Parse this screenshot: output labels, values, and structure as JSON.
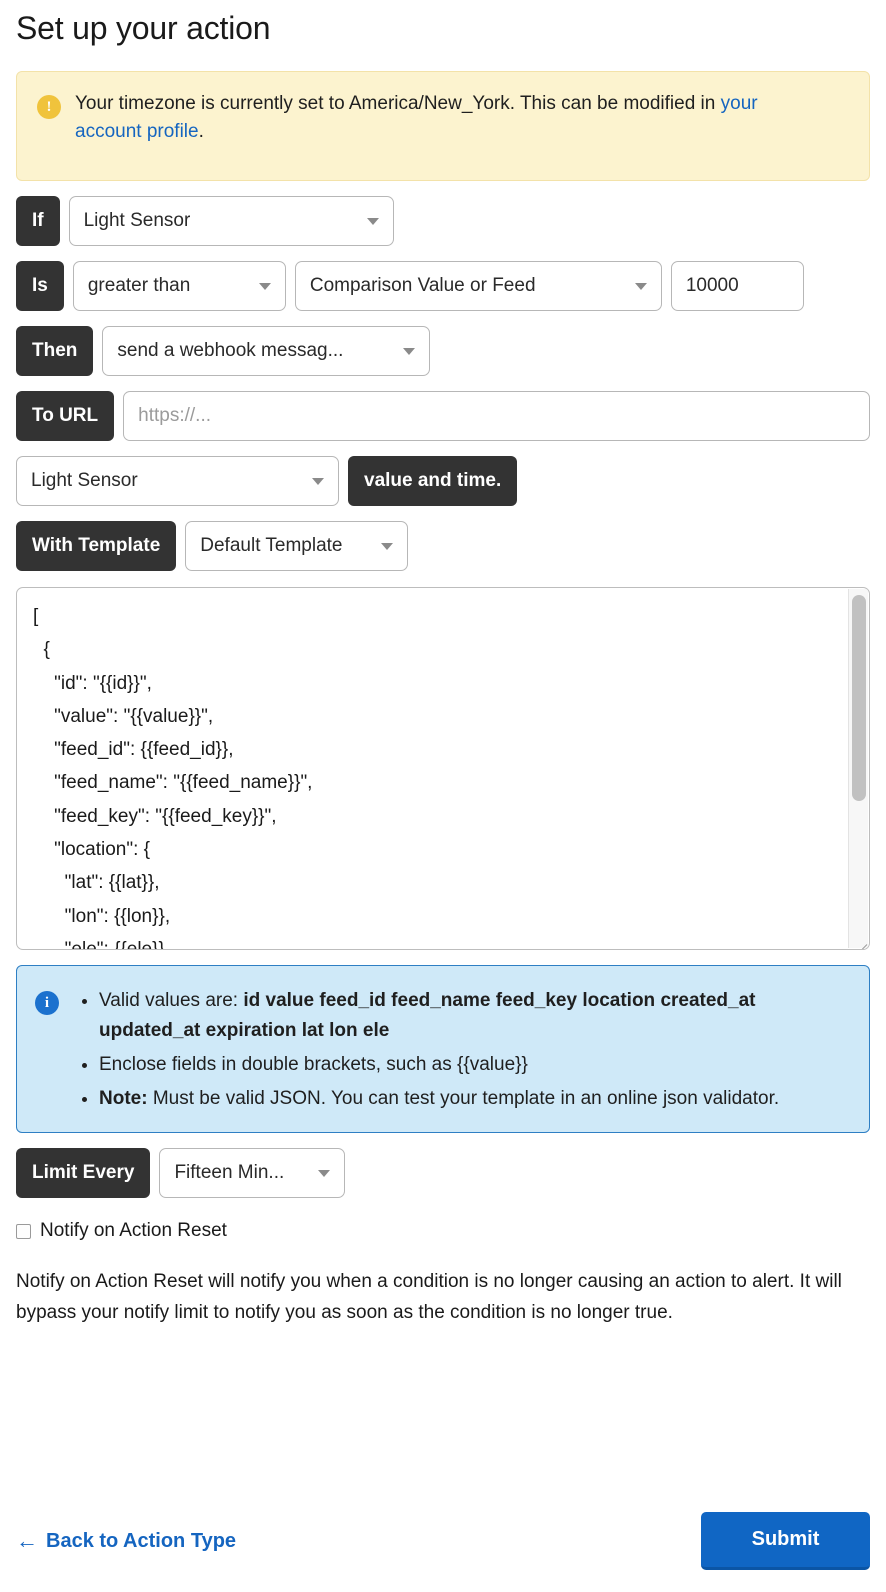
{
  "page": {
    "title": "Set up your action"
  },
  "timezone_alert": {
    "icon": "warning-icon",
    "text_before": "Your timezone is currently set to America/New_York. This can be modified in ",
    "link_text": "your account profile",
    "text_after": ".",
    "bg_color": "#fcf3cf",
    "icon_color": "#f0c33c",
    "link_color": "#1565c0"
  },
  "form": {
    "if_row": {
      "label": "If",
      "feed_select": {
        "value": "Light Sensor"
      }
    },
    "is_row": {
      "label": "Is",
      "operator_select": {
        "value": "greater than"
      },
      "compare_select": {
        "value": "Comparison Value or Feed"
      },
      "value_input": {
        "value": "10000"
      }
    },
    "then_row": {
      "label": "Then",
      "action_select": {
        "value": "send a webhook messag..."
      }
    },
    "to_url_row": {
      "label": "To URL",
      "url_input": {
        "value": "",
        "placeholder": "https://..."
      }
    },
    "feed_row": {
      "feed_select": {
        "value": "Light Sensor"
      },
      "tag": "value and time."
    },
    "template_row": {
      "label": "With Template",
      "template_select": {
        "value": "Default Template"
      }
    },
    "template_body": "[\n  {\n    \"id\": \"{{id}}\",\n    \"value\": \"{{value}}\",\n    \"feed_id\": {{feed_id}},\n    \"feed_name\": \"{{feed_name}}\",\n    \"feed_key\": \"{{feed_key}}\",\n    \"location\": {\n      \"lat\": {{lat}},\n      \"lon\": {{lon}},\n      \"ele\": {{ele}}\n    }",
    "limit_row": {
      "label": "Limit Every",
      "limit_select": {
        "value": "Fifteen Min..."
      }
    },
    "notify_checkbox": {
      "label": "Notify on Action Reset",
      "checked": false
    },
    "notify_help": "Notify on Action Reset will notify you when a condition is no longer causing an action to alert. It will bypass your notify limit to notify you as soon as the condition is no longer true."
  },
  "template_info": {
    "icon": "info-icon",
    "bg_color": "#cfe9f8",
    "border_color": "#2e7fc4",
    "items": [
      {
        "prefix": "Valid values are: ",
        "bold": "id value feed_id feed_name feed_key location created_at updated_at expiration lat lon ele",
        "suffix": ""
      },
      {
        "prefix": "Enclose fields in double brackets, such as {{value}}",
        "bold": "",
        "suffix": ""
      },
      {
        "prefix": "",
        "bold": "Note:",
        "suffix": " Must be valid JSON. You can test your template in an online json validator."
      }
    ]
  },
  "footer": {
    "back_link": "Back to Action Type",
    "back_arrow": "←",
    "submit_label": "Submit",
    "submit_color": "#1066c4",
    "link_color": "#1565c0"
  }
}
